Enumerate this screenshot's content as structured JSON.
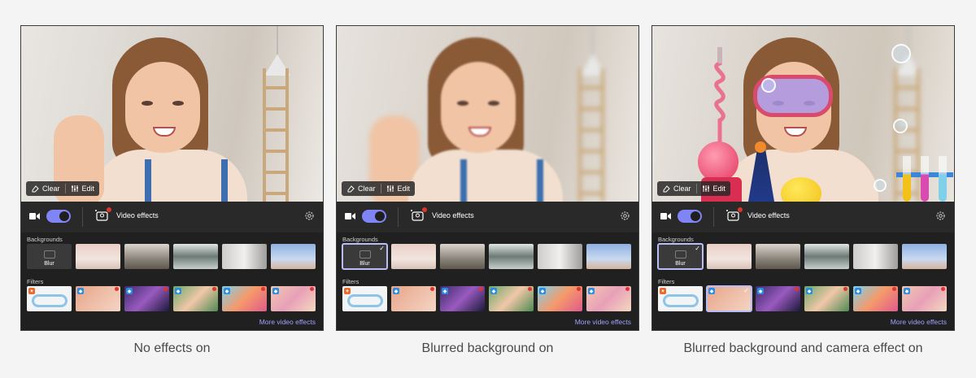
{
  "panels": [
    {
      "caption": "No effects on",
      "video_tools": {
        "clear_label": "Clear",
        "edit_label": "Edit"
      },
      "control_bar": {
        "camera_on": true,
        "video_effects_label": "Video effects"
      },
      "backgrounds_label": "Backgrounds",
      "blur_label": "Blur",
      "filters_label": "Filters",
      "more_label": "More video effects",
      "selected_background": "none",
      "selected_filter": "none"
    },
    {
      "caption": "Blurred background on",
      "video_tools": {
        "clear_label": "Clear",
        "edit_label": "Edit"
      },
      "control_bar": {
        "camera_on": true,
        "video_effects_label": "Video effects"
      },
      "backgrounds_label": "Backgrounds",
      "blur_label": "Blur",
      "filters_label": "Filters",
      "more_label": "More video effects",
      "selected_background": "Blur",
      "selected_filter": "none"
    },
    {
      "caption": "Blurred background and camera effect on",
      "video_tools": {
        "clear_label": "Clear",
        "edit_label": "Edit"
      },
      "control_bar": {
        "camera_on": true,
        "video_effects_label": "Video effects"
      },
      "backgrounds_label": "Backgrounds",
      "blur_label": "Blur",
      "filters_label": "Filters",
      "more_label": "More video effects",
      "selected_background": "Blur",
      "selected_filter": "filter-2"
    }
  ],
  "colors": {
    "accent": "#7f85f5",
    "link": "#9ea2ff",
    "notification_dot": "#e0352c",
    "panel_bg": "#202020",
    "page_bg": "#f4f4f4"
  }
}
